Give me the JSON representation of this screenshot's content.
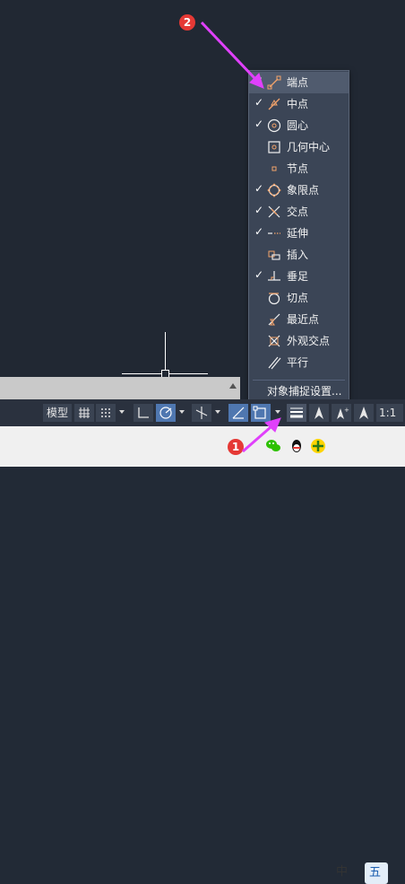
{
  "osnap_menu": {
    "items": [
      {
        "label": "端点",
        "checked": true,
        "icon": "endpoint-icon"
      },
      {
        "label": "中点",
        "checked": true,
        "icon": "midpoint-icon"
      },
      {
        "label": "圆心",
        "checked": true,
        "icon": "center-icon"
      },
      {
        "label": "几何中心",
        "checked": false,
        "icon": "geometric-center-icon"
      },
      {
        "label": "节点",
        "checked": false,
        "icon": "node-icon"
      },
      {
        "label": "象限点",
        "checked": true,
        "icon": "quadrant-icon"
      },
      {
        "label": "交点",
        "checked": true,
        "icon": "intersection-icon"
      },
      {
        "label": "延伸",
        "checked": true,
        "icon": "extension-icon"
      },
      {
        "label": "插入",
        "checked": false,
        "icon": "insertion-icon"
      },
      {
        "label": "垂足",
        "checked": true,
        "icon": "perpendicular-icon"
      },
      {
        "label": "切点",
        "checked": false,
        "icon": "tangent-icon"
      },
      {
        "label": "最近点",
        "checked": false,
        "icon": "nearest-icon"
      },
      {
        "label": "外观交点",
        "checked": false,
        "icon": "apparent-intersection-icon"
      },
      {
        "label": "平行",
        "checked": false,
        "icon": "parallel-icon"
      }
    ],
    "footer_label": "对象捕捉设置...",
    "check_glyph": "✓"
  },
  "statusbar": {
    "model_label": "模型",
    "scale_label": "1:1"
  },
  "annotations": {
    "badge_1": "1",
    "badge_2": "2"
  },
  "taskbar": {
    "ime_lang": "中",
    "ime_mode": "五"
  },
  "colors": {
    "accent": "#4f77b0",
    "marker": "#e040fb",
    "badge": "#e53935",
    "snap_icon": "#f2a36b"
  }
}
